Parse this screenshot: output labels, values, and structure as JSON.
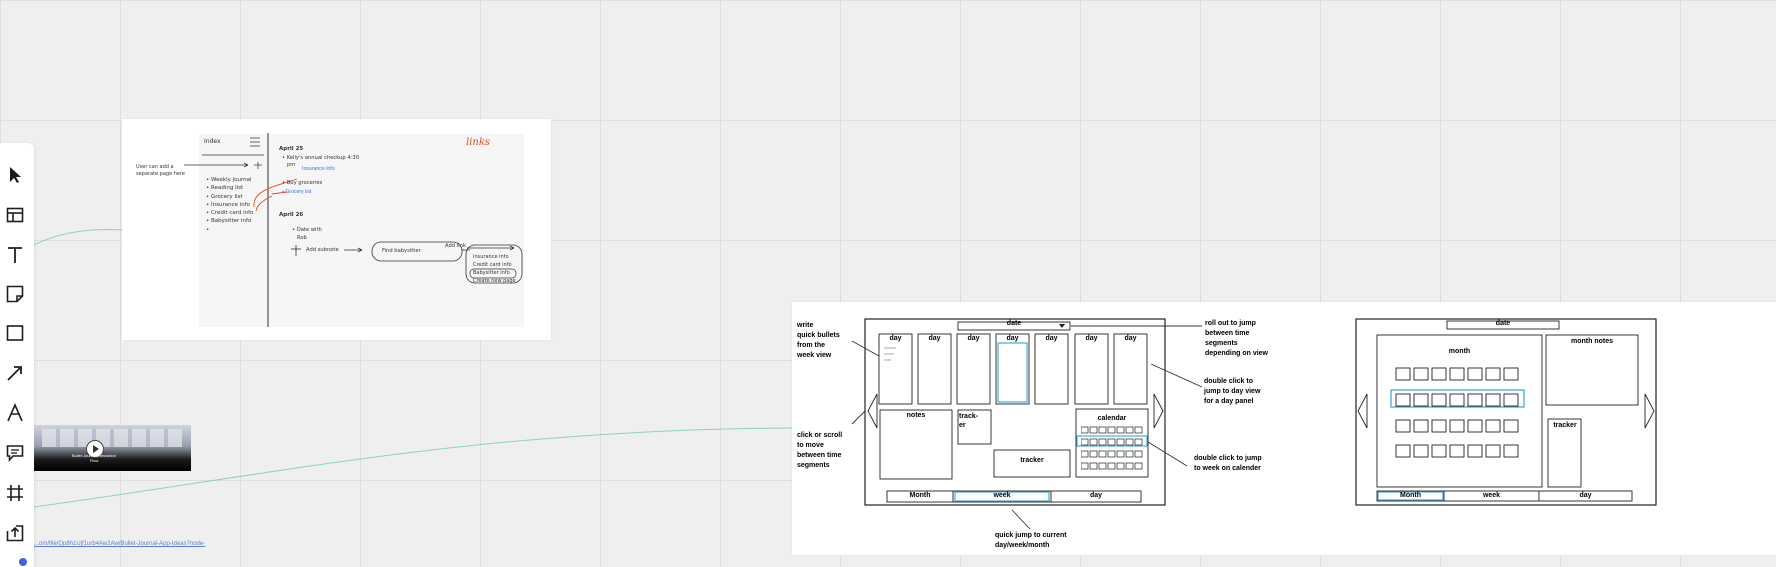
{
  "toolbar": {
    "tools": [
      {
        "name": "select-tool",
        "icon": "cursor-icon"
      },
      {
        "name": "template-tool",
        "icon": "layout-icon"
      },
      {
        "name": "text-tool",
        "icon": "text-icon"
      },
      {
        "name": "sticky-note-tool",
        "icon": "sticky-note-icon"
      },
      {
        "name": "shape-tool",
        "icon": "square-icon"
      },
      {
        "name": "connector-tool",
        "icon": "arrow-icon"
      },
      {
        "name": "pen-tool",
        "icon": "pen-icon"
      },
      {
        "name": "comment-tool",
        "icon": "comment-icon"
      },
      {
        "name": "frame-tool",
        "icon": "frame-icon"
      },
      {
        "name": "upload-tool",
        "icon": "upload-icon"
      }
    ]
  },
  "sketch_index": {
    "title": "Index",
    "items": [
      "Weekly journal",
      "Reading list",
      "Grocery list",
      "Insurance info",
      "Credit card info",
      "Babysitter info"
    ],
    "note": [
      "User can add a",
      "separate page here"
    ],
    "links_annotation": "links",
    "day1": {
      "heading": "April 25",
      "entry_line1": "Kelly's annual checkup 4:30",
      "entry_line2": "pm",
      "link1": "Insurance info",
      "bullet2": "Buy groceries",
      "link2": "Grocery list"
    },
    "day2": {
      "heading": "April 26",
      "entry_line1": "Date with",
      "entry_line2": "Rob",
      "add_subnote": "Add subnote",
      "pill": "Find babysitter",
      "add_link": "Add link"
    },
    "popup": [
      "Insurance info",
      "Credit card info",
      "Babysitter info",
      "Create new page"
    ]
  },
  "video_card": {
    "caption_line1": "Bullet Journal Interaction",
    "caption_line2": "Flow"
  },
  "url_text": "...om/file/Qp8h1Ujf1urb4Aw2Aw/Bullet-Journal-App-Ideas?node-",
  "week_view": {
    "date_label": "date",
    "day_label": "day",
    "notes_label": "notes",
    "tracker_small_line1": "track-",
    "tracker_small_line2": "er",
    "calendar_label": "calendar",
    "tracker_label": "tracker",
    "tabs": [
      "Month",
      "week",
      "day"
    ],
    "annotations": {
      "write_bullets": [
        "write",
        "quick bullets",
        "from the",
        "week view"
      ],
      "click_scroll": [
        "click or scroll",
        "to move",
        "between time",
        "segments"
      ],
      "roll_out": [
        "roll out to jump",
        "between time",
        "segments",
        "depending on view"
      ],
      "double_click_day": [
        "double click to",
        "jump to day view",
        "for a day panel"
      ],
      "double_click_week": [
        "double click to jump",
        "to week on calender"
      ],
      "quick_jump": [
        "quick jump to current",
        "day/week/month"
      ]
    }
  },
  "month_view": {
    "date_label": "date",
    "month_label": "month",
    "month_notes_label": "month notes",
    "tracker_label": "tracker",
    "tabs": [
      "Month",
      "week",
      "day"
    ]
  }
}
